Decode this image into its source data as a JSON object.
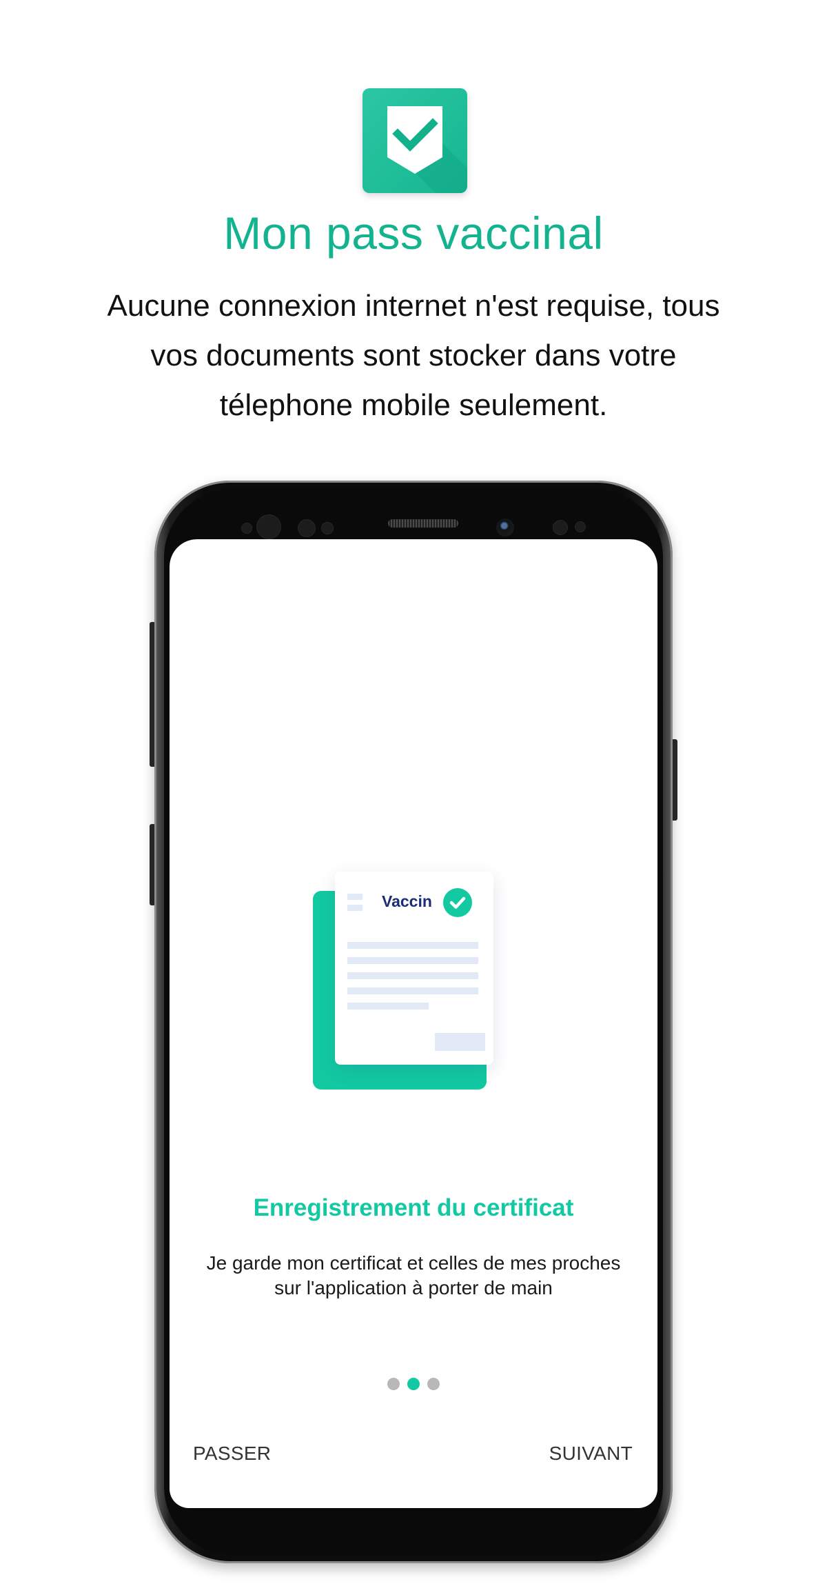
{
  "promo": {
    "title": "Mon pass vaccinal",
    "subtitle": "Aucune connexion internet n'est requise, tous vos documents sont stocker dans votre télephone mobile seulement.",
    "icon": "shield-check-icon",
    "accent_color": "#12b38e"
  },
  "onboarding": {
    "card_label": "Vaccin",
    "title": "Enregistrement du certificat",
    "description": "Je garde mon certificat et celles de mes proches sur l'application à porter de main",
    "pagination": {
      "total": 3,
      "active_index": 1
    },
    "skip_label": "PASSER",
    "next_label": "SUIVANT",
    "accent_color": "#12c9a2"
  }
}
